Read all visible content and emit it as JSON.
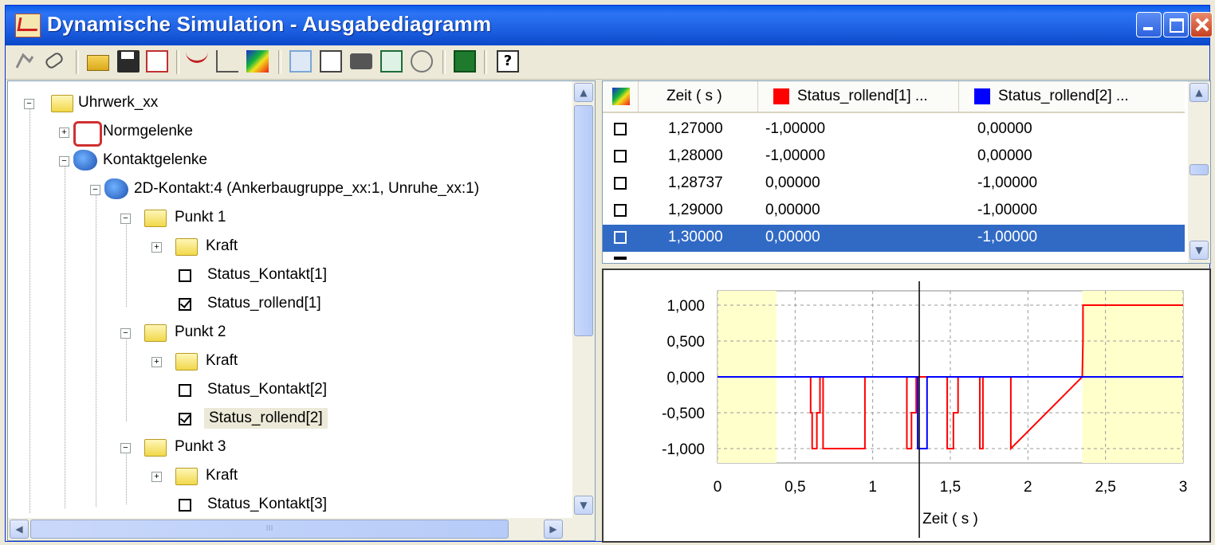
{
  "window": {
    "title": "Dynamische Simulation - Ausgabediagramm",
    "controls": [
      "minimize-icon",
      "maximize-icon",
      "close-icon"
    ]
  },
  "toolbar": {
    "icons": [
      "simulation-icon",
      "eraser-icon",
      "open-folder-icon",
      "save-icon",
      "export-icon",
      "curve-icon",
      "axes-icon",
      "colormap-icon",
      "pointer-icon",
      "copy-icon",
      "print-icon",
      "zoom-fit-icon",
      "zoom-icon",
      "excel-icon",
      "help-icon"
    ]
  },
  "tree": {
    "root": "Uhrwerk_xx",
    "normgelenke": "Normgelenke",
    "kontaktgelenke": "Kontaktgelenke",
    "contact": "2D-Kontakt:4 (Ankerbaugruppe_xx:1, Unruhe_xx:1)",
    "punkt1": "Punkt 1",
    "punkt2": "Punkt 2",
    "punkt3": "Punkt 3",
    "kraft": "Kraft",
    "status_kontakt_1": "Status_Kontakt[1]",
    "status_rollend_1": "Status_rollend[1]",
    "status_kontakt_2": "Status_Kontakt[2]",
    "status_rollend_2": "Status_rollend[2]",
    "status_kontakt_3": "Status_Kontakt[3]",
    "hscroll_grip": "III"
  },
  "table": {
    "headers": [
      "Zeit ( s )",
      "Status_rollend[1] ...",
      "Status_rollend[2] ..."
    ],
    "series_colors": [
      "#ff0000",
      "#0000ff"
    ],
    "rows": [
      {
        "t": "1,27000",
        "s1": "-1,00000",
        "s2": "0,00000",
        "selected": false
      },
      {
        "t": "1,28000",
        "s1": "-1,00000",
        "s2": "0,00000",
        "selected": false
      },
      {
        "t": "1,28737",
        "s1": "0,00000",
        "s2": "-1,00000",
        "selected": false
      },
      {
        "t": "1,29000",
        "s1": "0,00000",
        "s2": "-1,00000",
        "selected": false
      },
      {
        "t": "1,30000",
        "s1": "0,00000",
        "s2": "-1,00000",
        "selected": true
      }
    ]
  },
  "chart_data": {
    "type": "line",
    "xlabel": "Zeit ( s )",
    "xlim": [
      0,
      3
    ],
    "ylim": [
      -1.2,
      1.2
    ],
    "xticks": [
      "0",
      "0,5",
      "1",
      "1,5",
      "2",
      "2,5",
      "3"
    ],
    "xtick_values": [
      0,
      0.5,
      1,
      1.5,
      2,
      2.5,
      3
    ],
    "yticks": [
      "1,000",
      "0,500",
      "0,000",
      "-0,500",
      "-1,000"
    ],
    "ytick_values": [
      1,
      0.5,
      0,
      -0.5,
      -1
    ],
    "grid": true,
    "highlight_ranges": [
      [
        0,
        0.38
      ],
      [
        2.35,
        3
      ]
    ],
    "highlight_color": "#ffffcc",
    "cursor_x": 1.3,
    "series": [
      {
        "name": "Status_rollend[1]",
        "color": "#ff0000",
        "x": [
          0,
          0.6,
          0.6,
          0.61,
          0.61,
          0.64,
          0.64,
          0.66,
          0.66,
          0.68,
          0.68,
          0.95,
          0.95,
          1.22,
          1.22,
          1.25,
          1.25,
          1.28,
          1.28,
          1.48,
          1.48,
          1.52,
          1.52,
          1.55,
          1.55,
          1.69,
          1.69,
          1.71,
          1.71,
          1.89,
          1.89,
          2.35,
          2.35,
          2.355,
          2.355,
          3
        ],
        "y": [
          0,
          0,
          -0.5,
          -0.5,
          -1,
          -1,
          -0.5,
          -0.5,
          0,
          0,
          -1,
          -1,
          0,
          0,
          -1,
          -1,
          -0.5,
          -0.5,
          0,
          0,
          -1,
          -1,
          -0.5,
          -0.5,
          0,
          0,
          -1,
          -1,
          0,
          0,
          -1,
          0,
          0,
          0.5,
          1,
          1
        ]
      },
      {
        "name": "Status_rollend[2]",
        "color": "#0000ff",
        "x": [
          0,
          1.29,
          1.29,
          1.35,
          1.35,
          3
        ],
        "y": [
          0,
          0,
          -1,
          -1,
          0,
          0
        ]
      }
    ]
  }
}
